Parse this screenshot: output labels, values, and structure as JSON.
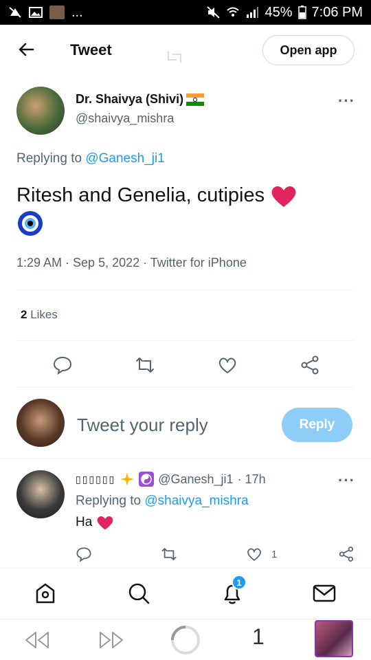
{
  "status_bar": {
    "battery": "45%",
    "time": "7:06 PM",
    "ellipsis": "..."
  },
  "header": {
    "title": "Tweet",
    "open_app_label": "Open app"
  },
  "tweet": {
    "author_name": "Dr. Shaivya (Shivi)",
    "author_handle": "@shaivya_mishra",
    "replying_prefix": "Replying to ",
    "replying_to": "@Ganesh_ji1",
    "text": "Ritesh and Genelia, cutipies",
    "timestamp": "1:29 AM · Sep 5, 2022 · Twitter for iPhone",
    "likes_count": "2",
    "likes_label": " Likes"
  },
  "compose": {
    "placeholder": "Tweet your reply",
    "reply_button": "Reply"
  },
  "reply": {
    "name_boxes": "▯▯▯▯▯▯",
    "handle": "@Ganesh_ji1",
    "time": "· 17h",
    "replying_prefix": "Replying to ",
    "replying_to": "@shaivya_mishra",
    "text": "Ha",
    "like_count": "1"
  },
  "tab_bar": {
    "notification_badge": "1"
  },
  "browser_bar": {
    "page_count": "1"
  },
  "colors": {
    "link": "#1d9bf0",
    "heart": "#e0245e",
    "reply_button": "#8ecdf7"
  }
}
